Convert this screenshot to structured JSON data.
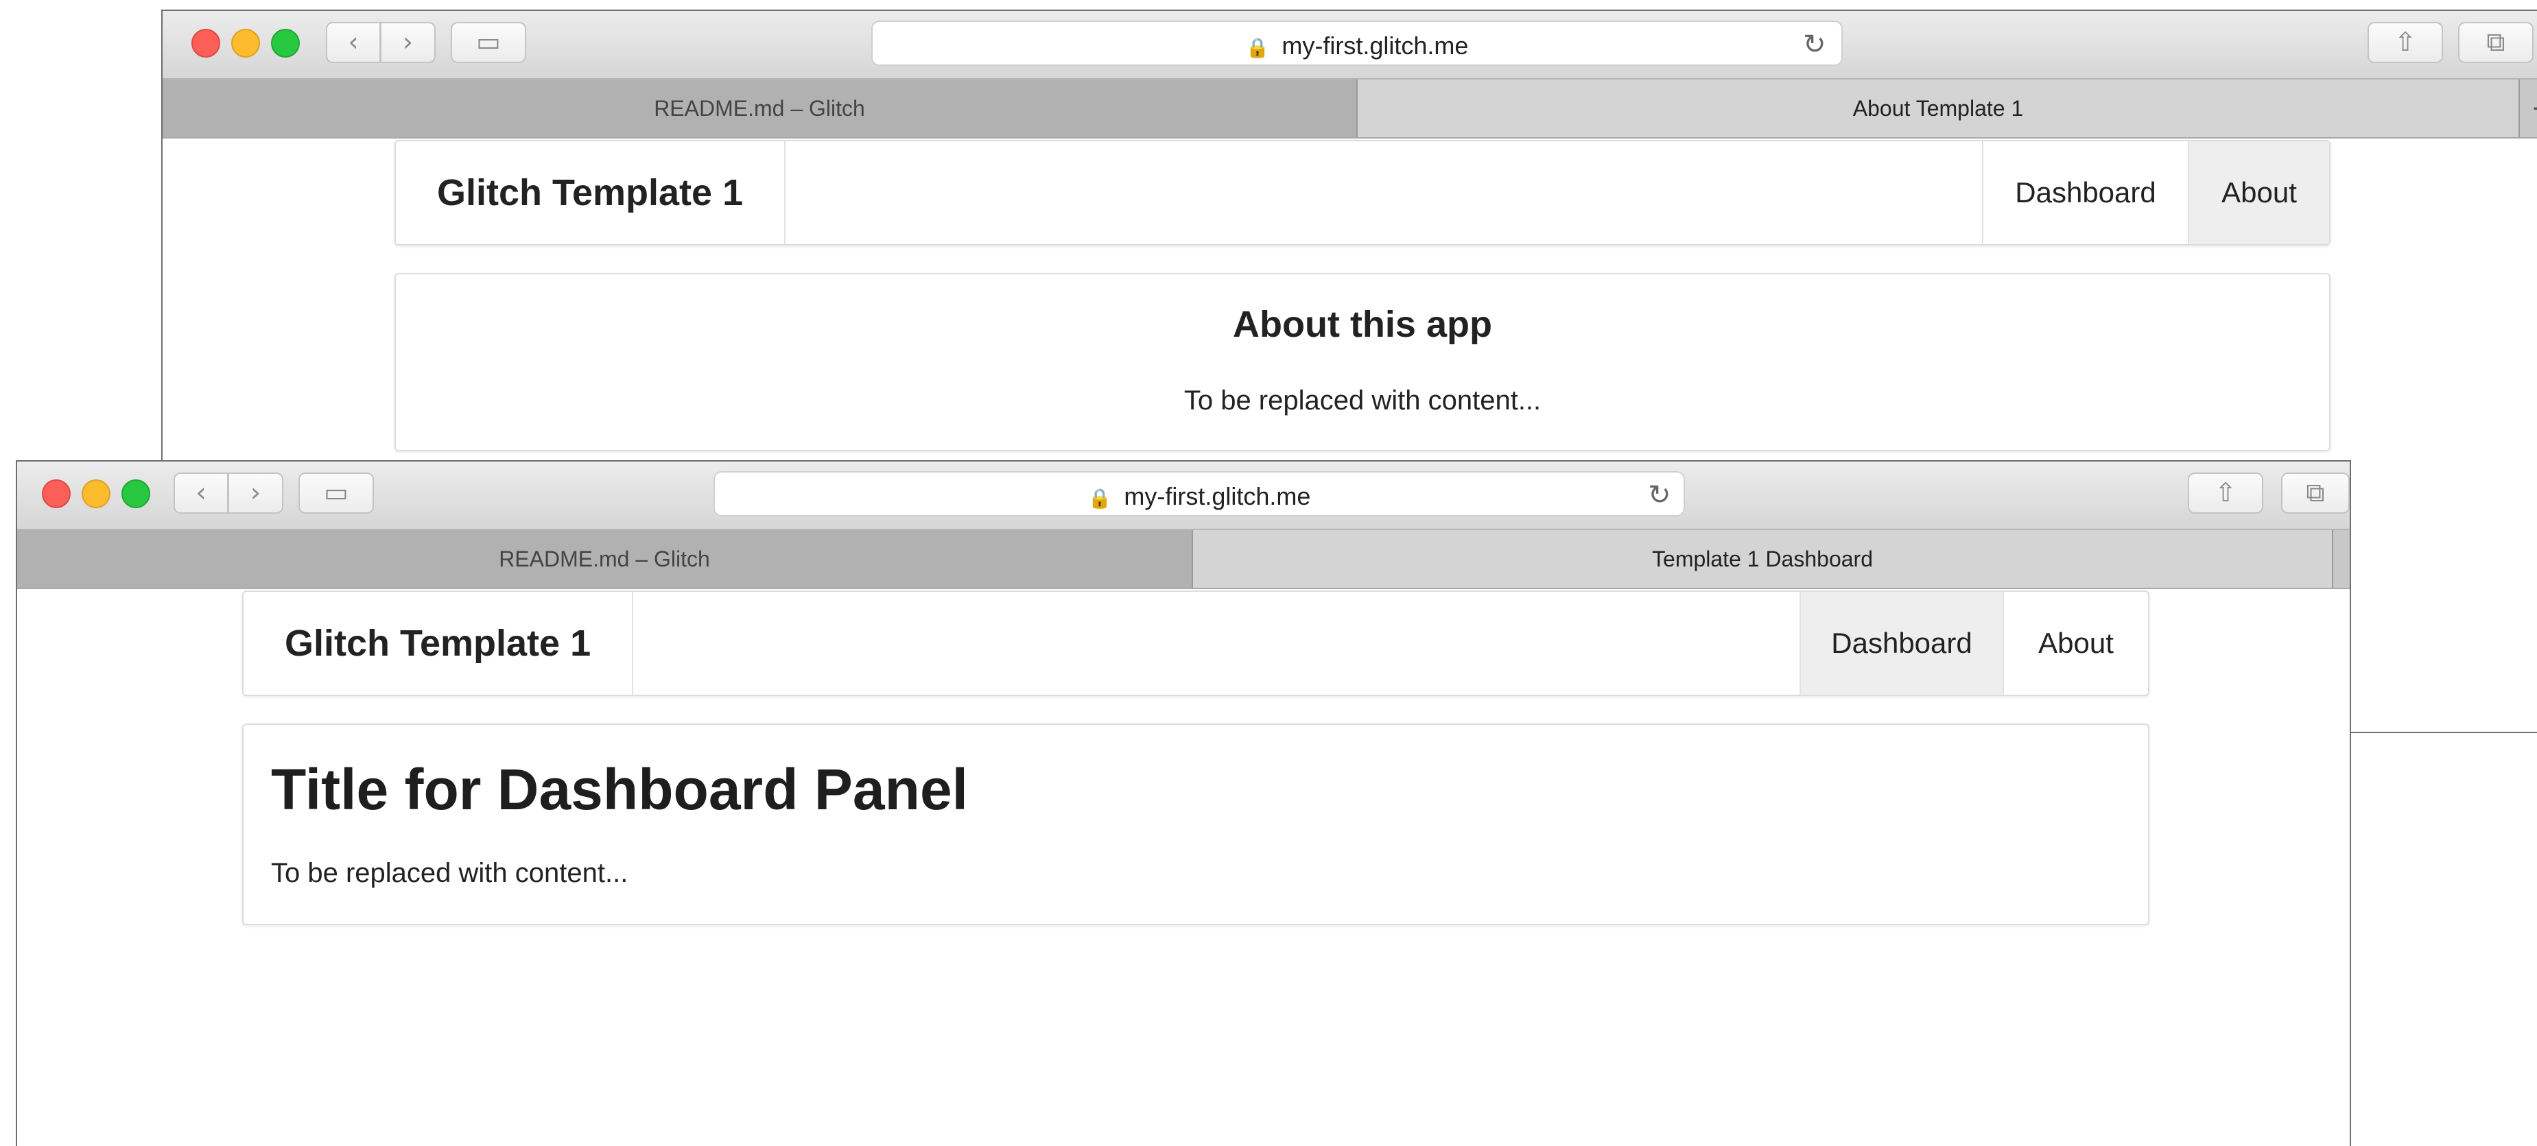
{
  "back_window": {
    "url": "my-first.glitch.me",
    "tabs": [
      {
        "label": "README.md – Glitch"
      },
      {
        "label": "About Template 1"
      }
    ],
    "new_tab_label": "+",
    "nav": {
      "brand": "Glitch Template 1",
      "links": [
        {
          "label": "Dashboard"
        },
        {
          "label": "About"
        }
      ],
      "active": "About"
    },
    "panel": {
      "title": "About this app",
      "body": "To be replaced with content..."
    }
  },
  "front_window": {
    "url": "my-first.glitch.me",
    "tabs": [
      {
        "label": "README.md – Glitch"
      },
      {
        "label": "Template 1 Dashboard"
      }
    ],
    "nav": {
      "brand": "Glitch Template 1",
      "links": [
        {
          "label": "Dashboard"
        },
        {
          "label": "About"
        }
      ],
      "active": "Dashboard"
    },
    "panel": {
      "title": "Title for Dashboard Panel",
      "body": "To be replaced with content..."
    }
  },
  "icons": {
    "back": "‹",
    "forward": "›",
    "sidebar": "▭",
    "lock": "🔒",
    "reload": "↻",
    "share": "⇧",
    "tabs": "⧉"
  },
  "colors": {
    "close": "#fc5f57",
    "minimize": "#fdbc2e",
    "zoom": "#28c840",
    "active_nav_bg": "#eeeeee"
  }
}
